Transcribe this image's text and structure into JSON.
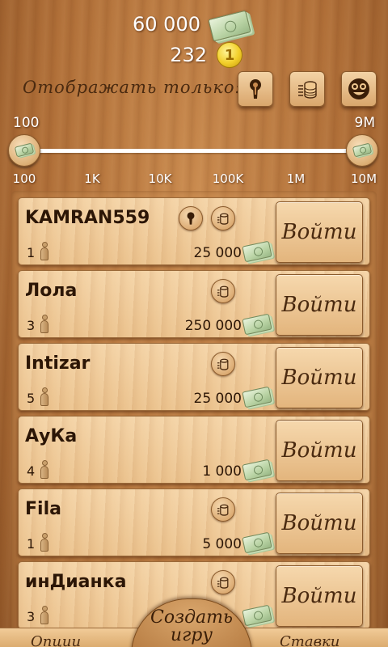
{
  "header": {
    "money": "60 000",
    "coins": "232",
    "coin_glyph": "1",
    "filter_label": "Отображать только:",
    "filters": [
      {
        "icon": "keyhole-icon"
      },
      {
        "icon": "coins-stack-icon"
      },
      {
        "icon": "face-icon"
      }
    ]
  },
  "slider": {
    "min_value": "100",
    "max_value": "9M",
    "ticks": [
      "100",
      "1K",
      "10K",
      "100K",
      "1M",
      "10M"
    ]
  },
  "rooms": [
    {
      "name": "KAMRAN559",
      "players": "1",
      "bet": "25 000",
      "join": "Войти",
      "features": [
        "keyhole-icon",
        "coins-stack-icon"
      ]
    },
    {
      "name": "Лола",
      "players": "3",
      "bet": "250 000",
      "join": "Войти",
      "features": [
        "coins-stack-icon"
      ]
    },
    {
      "name": "Intizar",
      "players": "5",
      "bet": "25 000",
      "join": "Войти",
      "features": [
        "coins-stack-icon"
      ]
    },
    {
      "name": "АуКа",
      "players": "4",
      "bet": "1 000",
      "join": "Войти",
      "features": []
    },
    {
      "name": "Fila",
      "players": "1",
      "bet": "5 000",
      "join": "Войти",
      "features": [
        "coins-stack-icon"
      ]
    },
    {
      "name": "инДианка",
      "players": "3",
      "bet": "",
      "join": "Войти",
      "features": [
        "coins-stack-icon"
      ]
    }
  ],
  "bottom": {
    "left_tab": "Опции",
    "create": "Создать игру",
    "right_tab": "Ставки"
  },
  "colors": {
    "wood": "#b06f38",
    "card": "#f4d3a6",
    "text_dark": "#2c1606",
    "coin": "#f2cf2a"
  }
}
